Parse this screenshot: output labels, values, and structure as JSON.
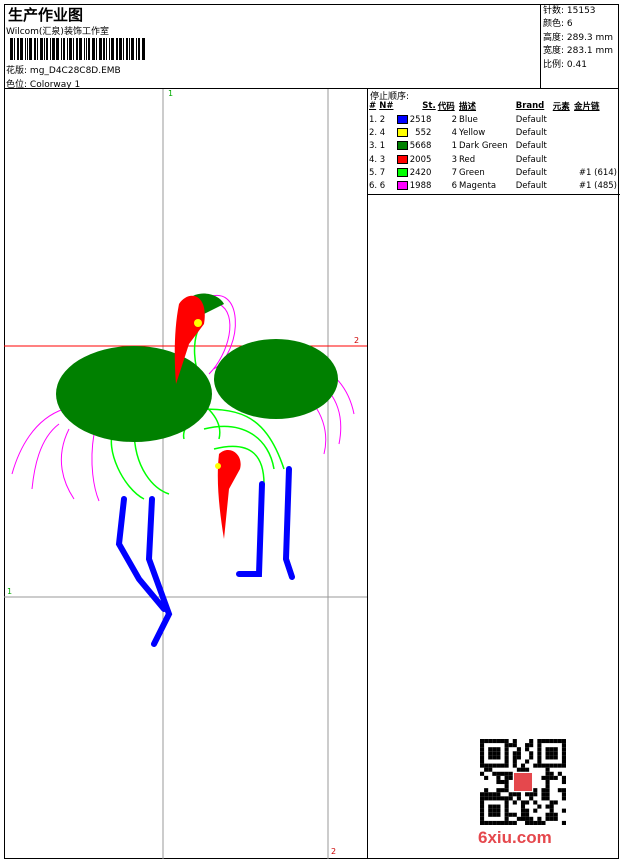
{
  "header": {
    "title": "生产作业图",
    "company": "Wilcom(汇泉)装饰工作室",
    "design_label": "花版:",
    "design_value": "mg_D4C28C8D.EMB",
    "colorway_label": "色位:",
    "colorway_value": "Colorway 1"
  },
  "info": {
    "stitches": "针数: 15153",
    "colors": "颜色: 6",
    "height": "高度: 289.3 mm",
    "width": "宽度: 283.1 mm",
    "scale": "比例: 0.41"
  },
  "stop_sequence": {
    "caption": "停止顺序:",
    "headers": [
      "#",
      "N#",
      "St.",
      "代码",
      "描述",
      "Brand",
      "元素",
      "金片链"
    ],
    "rows": [
      {
        "idx": "1. 2",
        "st": "2518",
        "code": "2",
        "desc": "Blue",
        "brand": "Default",
        "elem": "",
        "seq": "",
        "color": "#0000ff"
      },
      {
        "idx": "2. 4",
        "st": "552",
        "code": "4",
        "desc": "Yellow",
        "brand": "Default",
        "elem": "",
        "seq": "",
        "color": "#ffff00"
      },
      {
        "idx": "3. 1",
        "st": "5668",
        "code": "1",
        "desc": "Dark Green",
        "brand": "Default",
        "elem": "",
        "seq": "",
        "color": "#008000"
      },
      {
        "idx": "4. 3",
        "st": "2005",
        "code": "3",
        "desc": "Red",
        "brand": "Default",
        "elem": "",
        "seq": "",
        "color": "#ff0000"
      },
      {
        "idx": "5. 7",
        "st": "2420",
        "code": "7",
        "desc": "Green",
        "brand": "Default",
        "elem": "",
        "seq": "#1 (614)",
        "color": "#00ff00"
      },
      {
        "idx": "6. 6",
        "st": "1988",
        "code": "6",
        "desc": "Magenta",
        "brand": "Default",
        "elem": "",
        "seq": "#1 (485)",
        "color": "#ff00ff"
      }
    ]
  },
  "guides": {
    "v1": "1",
    "v2": "2",
    "h1": "1",
    "h2": "2"
  },
  "watermark": "6xiu.com"
}
